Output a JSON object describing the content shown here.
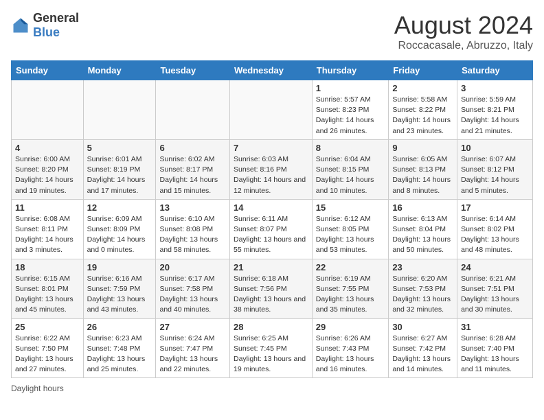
{
  "logo": {
    "general": "General",
    "blue": "Blue"
  },
  "title": "August 2024",
  "subtitle": "Roccacasale, Abruzzo, Italy",
  "days_of_week": [
    "Sunday",
    "Monday",
    "Tuesday",
    "Wednesday",
    "Thursday",
    "Friday",
    "Saturday"
  ],
  "footer": "Daylight hours",
  "weeks": [
    [
      {
        "day": "",
        "info": ""
      },
      {
        "day": "",
        "info": ""
      },
      {
        "day": "",
        "info": ""
      },
      {
        "day": "",
        "info": ""
      },
      {
        "day": "1",
        "info": "Sunrise: 5:57 AM\nSunset: 8:23 PM\nDaylight: 14 hours and 26 minutes."
      },
      {
        "day": "2",
        "info": "Sunrise: 5:58 AM\nSunset: 8:22 PM\nDaylight: 14 hours and 23 minutes."
      },
      {
        "day": "3",
        "info": "Sunrise: 5:59 AM\nSunset: 8:21 PM\nDaylight: 14 hours and 21 minutes."
      }
    ],
    [
      {
        "day": "4",
        "info": "Sunrise: 6:00 AM\nSunset: 8:20 PM\nDaylight: 14 hours and 19 minutes."
      },
      {
        "day": "5",
        "info": "Sunrise: 6:01 AM\nSunset: 8:19 PM\nDaylight: 14 hours and 17 minutes."
      },
      {
        "day": "6",
        "info": "Sunrise: 6:02 AM\nSunset: 8:17 PM\nDaylight: 14 hours and 15 minutes."
      },
      {
        "day": "7",
        "info": "Sunrise: 6:03 AM\nSunset: 8:16 PM\nDaylight: 14 hours and 12 minutes."
      },
      {
        "day": "8",
        "info": "Sunrise: 6:04 AM\nSunset: 8:15 PM\nDaylight: 14 hours and 10 minutes."
      },
      {
        "day": "9",
        "info": "Sunrise: 6:05 AM\nSunset: 8:13 PM\nDaylight: 14 hours and 8 minutes."
      },
      {
        "day": "10",
        "info": "Sunrise: 6:07 AM\nSunset: 8:12 PM\nDaylight: 14 hours and 5 minutes."
      }
    ],
    [
      {
        "day": "11",
        "info": "Sunrise: 6:08 AM\nSunset: 8:11 PM\nDaylight: 14 hours and 3 minutes."
      },
      {
        "day": "12",
        "info": "Sunrise: 6:09 AM\nSunset: 8:09 PM\nDaylight: 14 hours and 0 minutes."
      },
      {
        "day": "13",
        "info": "Sunrise: 6:10 AM\nSunset: 8:08 PM\nDaylight: 13 hours and 58 minutes."
      },
      {
        "day": "14",
        "info": "Sunrise: 6:11 AM\nSunset: 8:07 PM\nDaylight: 13 hours and 55 minutes."
      },
      {
        "day": "15",
        "info": "Sunrise: 6:12 AM\nSunset: 8:05 PM\nDaylight: 13 hours and 53 minutes."
      },
      {
        "day": "16",
        "info": "Sunrise: 6:13 AM\nSunset: 8:04 PM\nDaylight: 13 hours and 50 minutes."
      },
      {
        "day": "17",
        "info": "Sunrise: 6:14 AM\nSunset: 8:02 PM\nDaylight: 13 hours and 48 minutes."
      }
    ],
    [
      {
        "day": "18",
        "info": "Sunrise: 6:15 AM\nSunset: 8:01 PM\nDaylight: 13 hours and 45 minutes."
      },
      {
        "day": "19",
        "info": "Sunrise: 6:16 AM\nSunset: 7:59 PM\nDaylight: 13 hours and 43 minutes."
      },
      {
        "day": "20",
        "info": "Sunrise: 6:17 AM\nSunset: 7:58 PM\nDaylight: 13 hours and 40 minutes."
      },
      {
        "day": "21",
        "info": "Sunrise: 6:18 AM\nSunset: 7:56 PM\nDaylight: 13 hours and 38 minutes."
      },
      {
        "day": "22",
        "info": "Sunrise: 6:19 AM\nSunset: 7:55 PM\nDaylight: 13 hours and 35 minutes."
      },
      {
        "day": "23",
        "info": "Sunrise: 6:20 AM\nSunset: 7:53 PM\nDaylight: 13 hours and 32 minutes."
      },
      {
        "day": "24",
        "info": "Sunrise: 6:21 AM\nSunset: 7:51 PM\nDaylight: 13 hours and 30 minutes."
      }
    ],
    [
      {
        "day": "25",
        "info": "Sunrise: 6:22 AM\nSunset: 7:50 PM\nDaylight: 13 hours and 27 minutes."
      },
      {
        "day": "26",
        "info": "Sunrise: 6:23 AM\nSunset: 7:48 PM\nDaylight: 13 hours and 25 minutes."
      },
      {
        "day": "27",
        "info": "Sunrise: 6:24 AM\nSunset: 7:47 PM\nDaylight: 13 hours and 22 minutes."
      },
      {
        "day": "28",
        "info": "Sunrise: 6:25 AM\nSunset: 7:45 PM\nDaylight: 13 hours and 19 minutes."
      },
      {
        "day": "29",
        "info": "Sunrise: 6:26 AM\nSunset: 7:43 PM\nDaylight: 13 hours and 16 minutes."
      },
      {
        "day": "30",
        "info": "Sunrise: 6:27 AM\nSunset: 7:42 PM\nDaylight: 13 hours and 14 minutes."
      },
      {
        "day": "31",
        "info": "Sunrise: 6:28 AM\nSunset: 7:40 PM\nDaylight: 13 hours and 11 minutes."
      }
    ]
  ]
}
